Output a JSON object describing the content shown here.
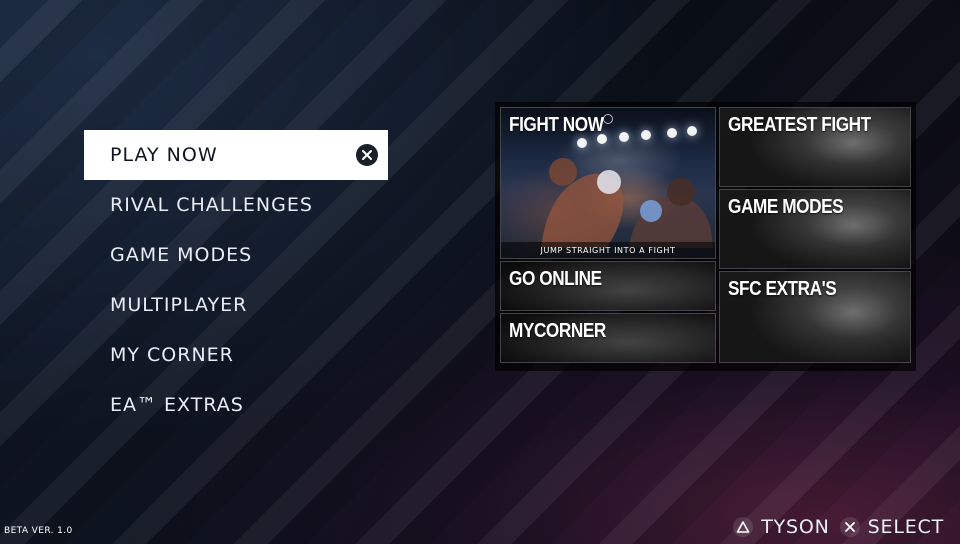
{
  "menu": {
    "items": [
      {
        "label": "PLAY NOW",
        "active": true
      },
      {
        "label": "RIVAL CHALLENGES",
        "active": false
      },
      {
        "label": "GAME MODES",
        "active": false
      },
      {
        "label": "MULTIPLAYER",
        "active": false
      },
      {
        "label": "MY CORNER",
        "active": false
      },
      {
        "label": "EA™ EXTRAS",
        "active": false
      }
    ],
    "active_icon": "cross-button-icon"
  },
  "tiles": {
    "fight_now": {
      "title": "FIGHT NOW",
      "caption": "JUMP STRAIGHT INTO A FIGHT"
    },
    "greatest_fight": {
      "title": "GREATEST FIGHT"
    },
    "game_modes": {
      "title": "GAME MODES"
    },
    "go_online": {
      "title": "GO ONLINE"
    },
    "mycorner": {
      "title": "MYCORNER"
    },
    "sfc_extras": {
      "title": "SFC EXTRA'S"
    }
  },
  "footer": {
    "version": "BETA VER. 1.0",
    "hint_left": {
      "icon": "triangle-button-icon",
      "label": "TYSON"
    },
    "hint_right": {
      "icon": "cross-button-icon",
      "label": "SELECT"
    }
  },
  "colors": {
    "active_bg": "#ffffff",
    "active_text": "#0f1420",
    "menu_text": "#e9eef6",
    "background_accent": "#78284f"
  }
}
